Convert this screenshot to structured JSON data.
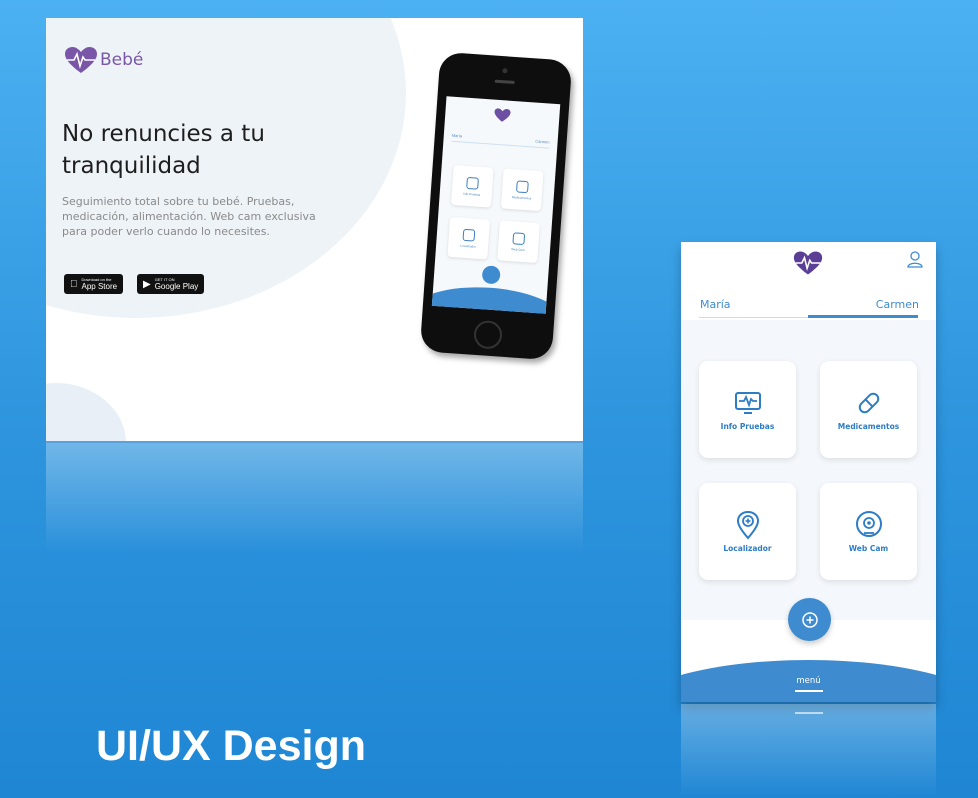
{
  "landing": {
    "logo_text": "Bebé",
    "headline": "No renuncies a tu tranquilidad",
    "description": "Seguimiento total sobre tu bebé. Pruebas, medicación, alimentación. Web cam exclusiva para poder verlo cuando lo necesites.",
    "badges": [
      {
        "small": "Download on the",
        "big": "App Store",
        "icon": "apple-icon"
      },
      {
        "small": "GET IT ON",
        "big": "Google Play",
        "icon": "play-icon"
      }
    ]
  },
  "app": {
    "tabs": [
      "María",
      "Carmen"
    ],
    "active_tab": "Carmen",
    "tiles": [
      {
        "label": "Info Pruebas",
        "icon": "monitor-heartbeat-icon"
      },
      {
        "label": "Medicamentos",
        "icon": "pill-icon"
      },
      {
        "label": "Localizador",
        "icon": "location-pin-icon"
      },
      {
        "label": "Web Cam",
        "icon": "webcam-icon"
      }
    ],
    "fab_icon": "plus-circle-icon",
    "menu_label": "menú"
  },
  "caption": "UI/UX Design",
  "colors": {
    "accent_blue": "#3e8bd0",
    "brand_purple": "#7a56a8",
    "background_blue": "#2d94dd"
  }
}
